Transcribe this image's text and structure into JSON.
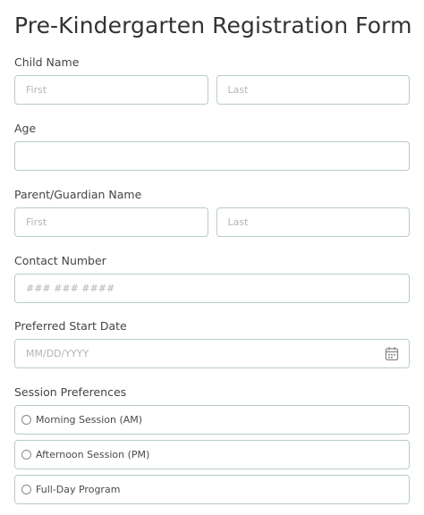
{
  "form": {
    "title": "Pre-Kindergarten Registration Form"
  },
  "child_name": {
    "label": "Child Name",
    "first_placeholder": "First",
    "last_placeholder": "Last"
  },
  "age": {
    "label": "Age",
    "value": ""
  },
  "parent_name": {
    "label": "Parent/Guardian Name",
    "first_placeholder": "First",
    "last_placeholder": "Last"
  },
  "contact": {
    "label": "Contact Number",
    "placeholder": "### ### ####"
  },
  "start_date": {
    "label": "Preferred Start Date",
    "placeholder": "MM/DD/YYYY",
    "icon": "calendar-icon"
  },
  "session": {
    "label": "Session Preferences",
    "options": [
      {
        "label": "Morning Session (AM)",
        "selected": false
      },
      {
        "label": "Afternoon Session (PM)",
        "selected": false
      },
      {
        "label": "Full-Day Program",
        "selected": false
      }
    ]
  },
  "colors": {
    "input_border": "#b9ccc7",
    "text": "#3a3a3a",
    "placeholder": "#b5b5b5"
  }
}
